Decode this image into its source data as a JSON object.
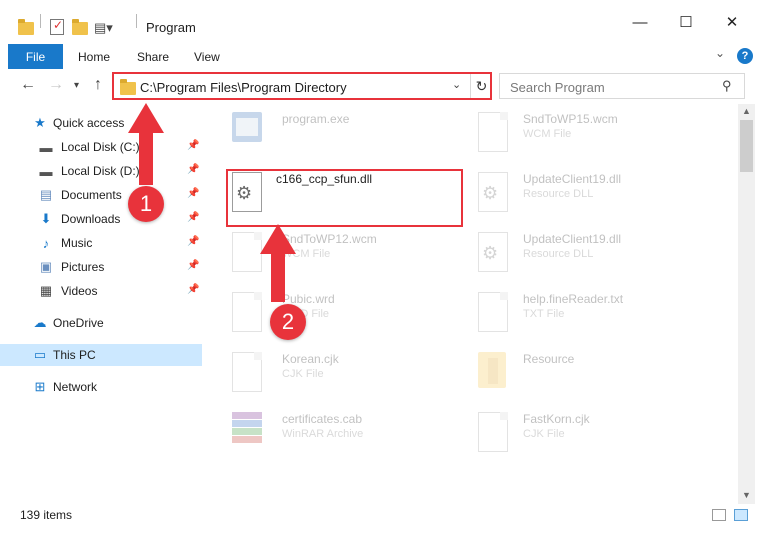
{
  "window": {
    "title": "Program",
    "minimize_glyph": "—",
    "maximize_glyph": "☐",
    "close_glyph": "✕"
  },
  "ribbon": {
    "tabs": [
      "File",
      "Home",
      "Share",
      "View"
    ],
    "help_label": "?"
  },
  "nav": {
    "address": "C:\\Program Files\\Program Directory",
    "search_placeholder": "Search Program"
  },
  "sidebar": {
    "items": [
      {
        "label": "Quick access",
        "icon": "star-icon"
      },
      {
        "label": "Local Disk (C:)",
        "icon": "drive-icon",
        "pinned": true
      },
      {
        "label": "Local Disk (D:)",
        "icon": "drive-icon",
        "pinned": true
      },
      {
        "label": "Documents",
        "icon": "documents-icon",
        "pinned": true
      },
      {
        "label": "Downloads",
        "icon": "download-icon",
        "pinned": true
      },
      {
        "label": "Music",
        "icon": "music-icon",
        "pinned": true
      },
      {
        "label": "Pictures",
        "icon": "pictures-icon",
        "pinned": true
      },
      {
        "label": "Videos",
        "icon": "videos-icon",
        "pinned": true
      },
      {
        "label": "OneDrive",
        "icon": "cloud-icon"
      },
      {
        "label": "This PC",
        "icon": "computer-icon",
        "selected": true
      },
      {
        "label": "Network",
        "icon": "network-icon"
      }
    ]
  },
  "files": {
    "left": [
      {
        "name": "program.exe",
        "type": "",
        "faded": true
      },
      {
        "name": "c166_ccp_sfun.dll",
        "type": "",
        "faded": false
      },
      {
        "name": "SndToWP12.wcm",
        "type": "WCM File",
        "faded": true
      },
      {
        "name": "Pubic.wrd",
        "type": "WRD File",
        "faded": true
      },
      {
        "name": "Korean.cjk",
        "type": "CJK File",
        "faded": true
      },
      {
        "name": "certificates.cab",
        "type": "WinRAR Archive",
        "faded": true
      }
    ],
    "right": [
      {
        "name": "SndToWP15.wcm",
        "type": "WCM File",
        "faded": true
      },
      {
        "name": "UpdateClient19.dll",
        "type": "Resource DLL",
        "faded": true
      },
      {
        "name": "UpdateClient19.dll",
        "type": "Resource DLL",
        "faded": true
      },
      {
        "name": "help.fineReader.txt",
        "type": "TXT File",
        "faded": true
      },
      {
        "name": "Resource",
        "type": "",
        "faded": true
      },
      {
        "name": "FastKorn.cjk",
        "type": "CJK File",
        "faded": true
      }
    ]
  },
  "status": {
    "item_count": "139 items"
  },
  "annotations": {
    "step1": "1",
    "step2": "2",
    "color": "#e8333b"
  }
}
